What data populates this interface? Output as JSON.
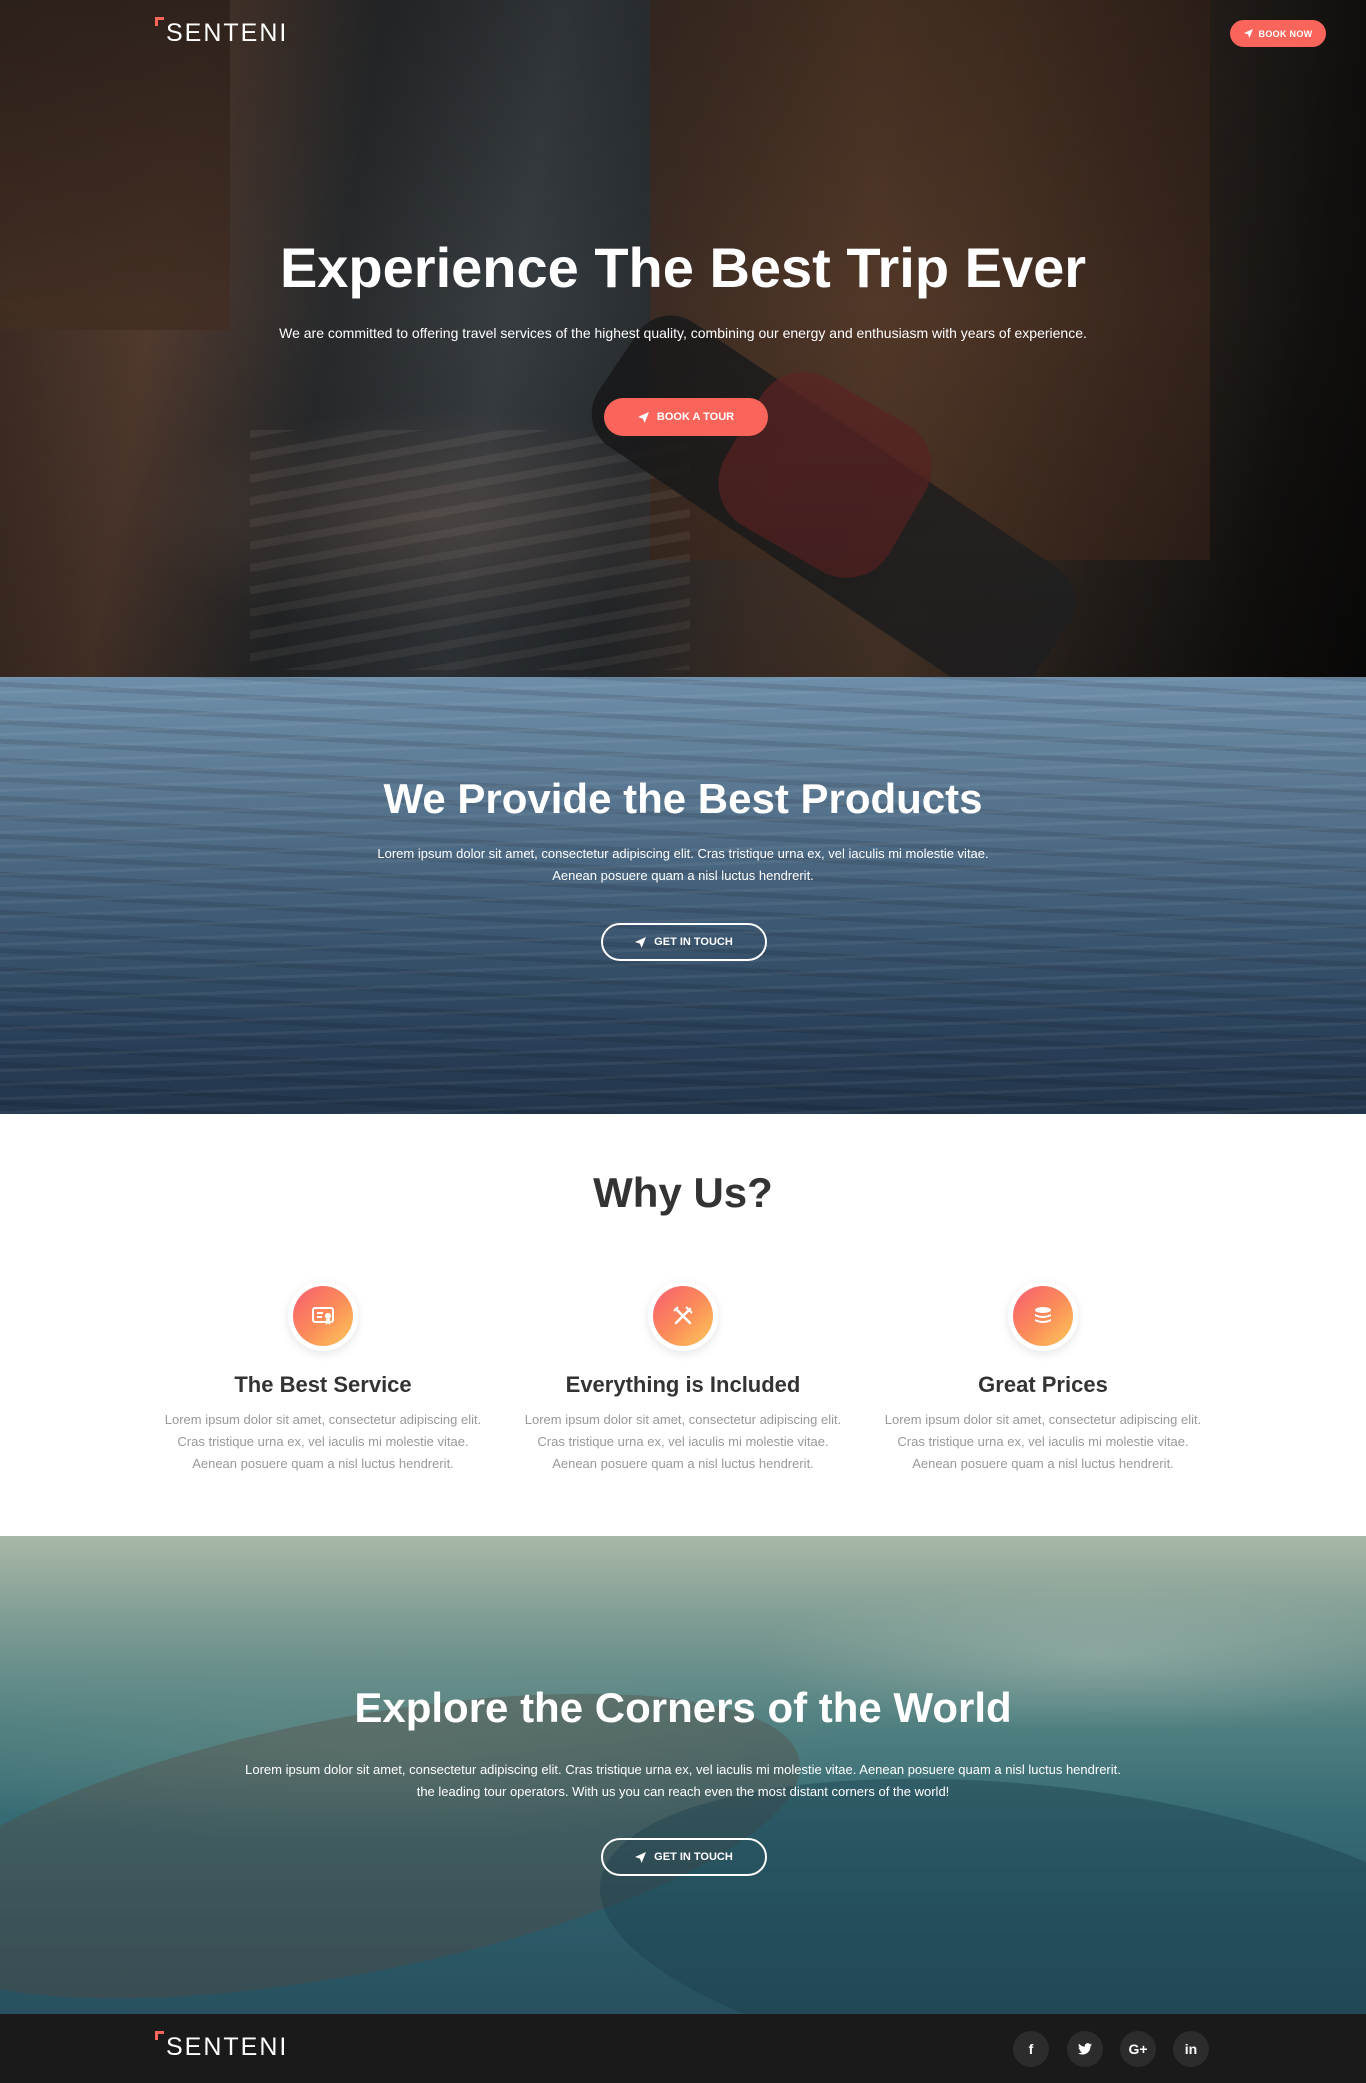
{
  "brand": {
    "name": "SENTENI",
    "accent": "#f9655b"
  },
  "header": {
    "book_now_label": "BOOK NOW"
  },
  "hero": {
    "title": "Experience The Best Trip Ever",
    "subtitle": "We are committed to offering travel services of the highest quality, combining our energy and enthusiasm with years of experience.",
    "cta_label": "BOOK A TOUR"
  },
  "products": {
    "title": "We Provide the Best Products",
    "text_line1": "Lorem ipsum dolor sit amet, consectetur adipiscing elit. Cras tristique urna ex, vel iaculis mi molestie vitae.",
    "text_line2": "Aenean posuere quam a nisl luctus hendrerit.",
    "cta_label": "GET IN TOUCH"
  },
  "why_us": {
    "title": "Why Us?",
    "features": [
      {
        "icon": "certificate-icon",
        "title": "The Best Service",
        "text": "Lorem ipsum dolor sit amet, consectetur adipiscing elit. Cras tristique urna ex, vel iaculis mi molestie vitae. Aenean posuere quam a nisl luctus hendrerit."
      },
      {
        "icon": "fork-knife-icon",
        "title": "Everything is Included",
        "text": "Lorem ipsum dolor sit amet, consectetur adipiscing elit. Cras tristique urna ex, vel iaculis mi molestie vitae. Aenean posuere quam a nisl luctus hendrerit."
      },
      {
        "icon": "coins-icon",
        "title": "Great Prices",
        "text": "Lorem ipsum dolor sit amet, consectetur adipiscing elit. Cras tristique urna ex, vel iaculis mi molestie vitae. Aenean posuere quam a nisl luctus hendrerit."
      }
    ]
  },
  "explore": {
    "title": "Explore the Corners of the World",
    "text_line1": "Lorem ipsum dolor sit amet, consectetur adipiscing elit. Cras tristique urna ex, vel iaculis mi molestie vitae. Aenean posuere quam a nisl luctus hendrerit.",
    "text_line2": "the leading tour operators. With us you can reach even the most distant corners of the world!",
    "cta_label": "GET IN TOUCH"
  },
  "footer": {
    "social": [
      {
        "icon": "facebook-icon",
        "glyph": "f"
      },
      {
        "icon": "twitter-icon",
        "glyph": "🐦"
      },
      {
        "icon": "google-plus-icon",
        "glyph": "G+"
      },
      {
        "icon": "linkedin-icon",
        "glyph": "in"
      }
    ]
  }
}
